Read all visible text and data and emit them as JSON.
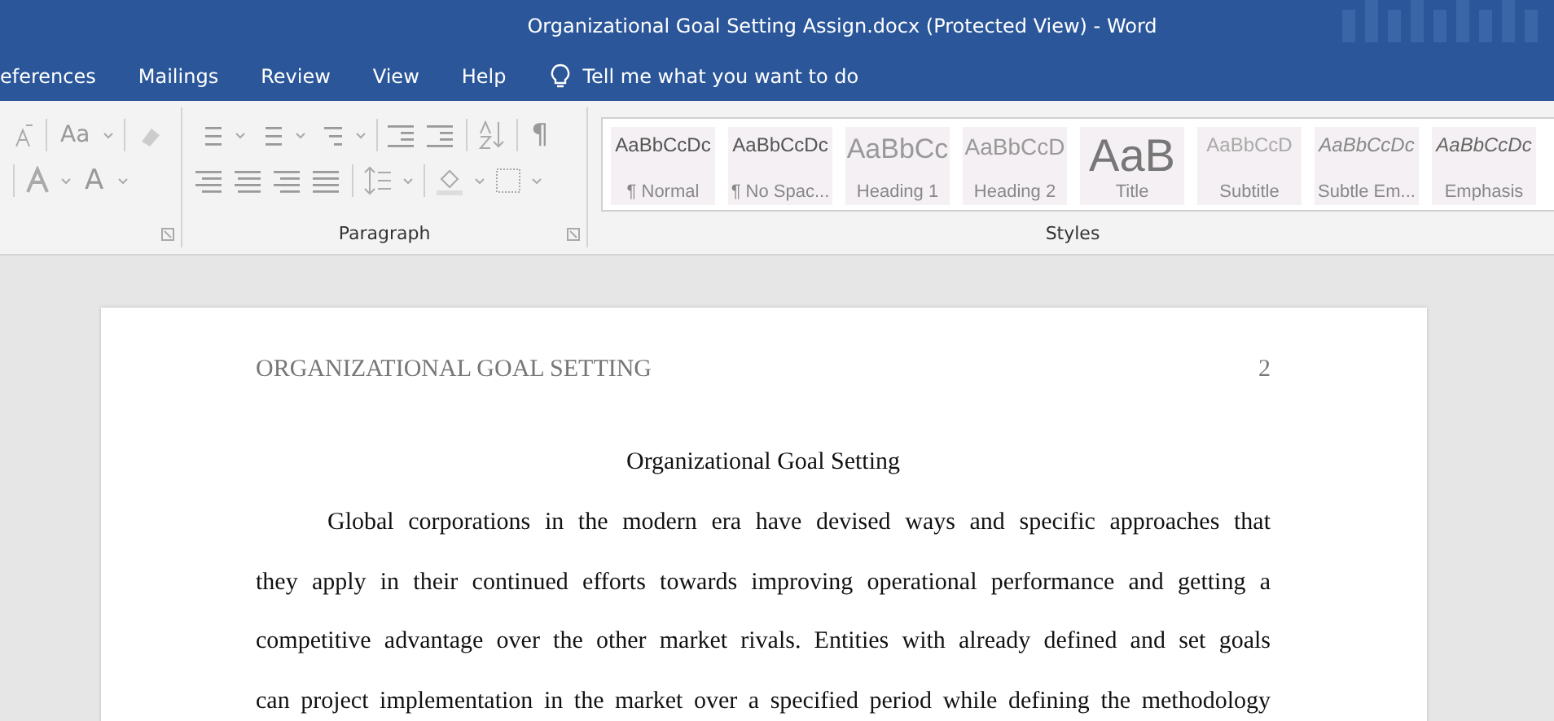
{
  "window": {
    "title": "Organizational Goal Setting Assign.docx (Protected View)  -  Word"
  },
  "menu": [
    {
      "label": "eferences",
      "selected": false
    },
    {
      "label": "Mailings",
      "selected": false
    },
    {
      "label": "Review",
      "selected": false
    },
    {
      "label": "View",
      "selected": false
    },
    {
      "label": "Help",
      "selected": false
    }
  ],
  "tell_me": {
    "placeholder": "Tell me what you want to do"
  },
  "font_group": {
    "case_button": "Aa",
    "color_button": "A"
  },
  "paragraph_group": {
    "label": "Paragraph",
    "marks_button": "¶"
  },
  "styles_group": {
    "label": "Styles",
    "styles": [
      {
        "sample": "AaBbCcDc",
        "name": "¶ Normal",
        "kind": "normal"
      },
      {
        "sample": "AaBbCcDc",
        "name": "¶ No Spac...",
        "kind": "normal"
      },
      {
        "sample": "AaBbCc",
        "name": "Heading 1",
        "kind": "heading1"
      },
      {
        "sample": "AaBbCcD",
        "name": "Heading 2",
        "kind": "heading2"
      },
      {
        "sample": "AaB",
        "name": "Title",
        "kind": "title"
      },
      {
        "sample": "AaBbCcD",
        "name": "Subtitle",
        "kind": "subtitle"
      },
      {
        "sample": "AaBbCcDc",
        "name": "Subtle Em...",
        "kind": "subtle"
      },
      {
        "sample": "AaBbCcDc",
        "name": "Emphasis",
        "kind": "emphasis"
      }
    ]
  },
  "document": {
    "header": "ORGANIZATIONAL GOAL SETTING",
    "page_number": "2",
    "title": "Organizational Goal Setting",
    "paragraph_lines": [
      "Global corporations in the modern era have devised ways and specific approaches that",
      "they apply in their continued efforts towards improving operational performance and getting a",
      "competitive advantage over the other market rivals. Entities with already defined and set goals",
      "can project implementation in the market over a specified period while defining the methodology"
    ]
  }
}
